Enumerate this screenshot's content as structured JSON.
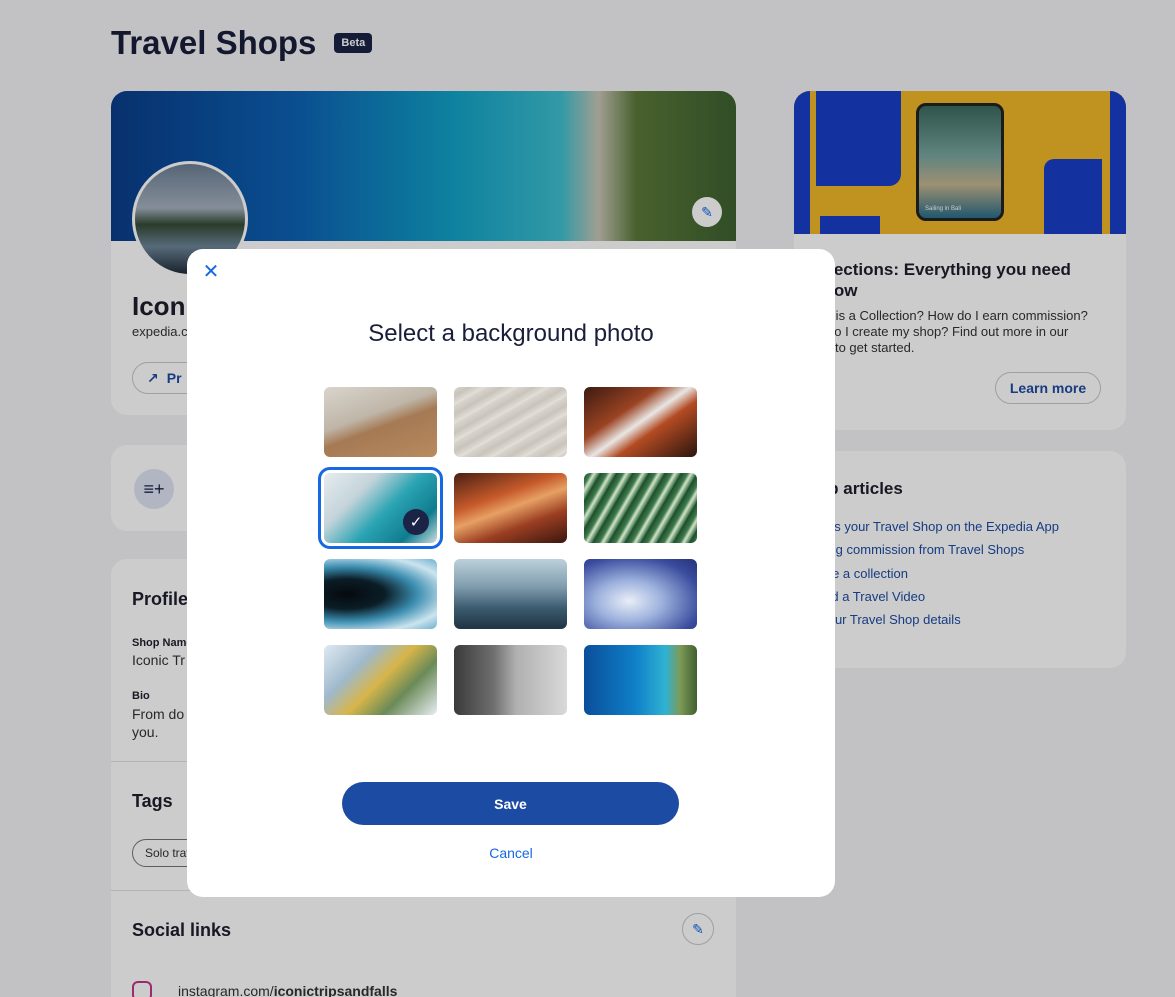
{
  "page": {
    "title": "Travel Shops",
    "beta_badge": "Beta"
  },
  "shop": {
    "name_partial": "Iconi",
    "url_partial": "expedia.c",
    "preview_partial": "Pr"
  },
  "profile": {
    "section_title_partial": "Profile",
    "shop_name_label_partial": "Shop Name",
    "shop_name_value_partial": "Iconic Tr",
    "bio_label": "Bio",
    "bio_value_line1_partial": "From do",
    "bio_value_line2": "you."
  },
  "tags": {
    "title": "Tags",
    "chip_partial": "Solo trav"
  },
  "social": {
    "title": "Social links",
    "instagram_prefix": "instagram.com/",
    "instagram_handle": "iconictripsandfalls"
  },
  "promo": {
    "phone_caption": "Sailing in Bali",
    "title": "ollections: Everything you need\n know",
    "body": "hat is a Collection? How do I earn commission?\nw do I create my shop? Find out more in our\nide to get started.",
    "learn_more": "Learn more"
  },
  "help": {
    "title": "elp articles",
    "links": [
      "cess your Travel Shop on the Expedia App",
      "rning commission from Travel Shops",
      "eate a collection",
      "load a Travel Video",
      "t your Travel Shop details"
    ]
  },
  "modal": {
    "close_icon": "close-icon",
    "title": "Select a background photo",
    "selected_index": 3,
    "photos": [
      "beach-sand-photo",
      "sand-dunes-photo",
      "canyon-orange-photo",
      "glacier-teal-photo",
      "antelope-canyon-photo",
      "green-leaves-photo",
      "ice-cave-photo",
      "misty-mountains-photo",
      "blue-clouds-photo",
      "yellow-flowers-photo",
      "grey-rock-photo",
      "coastline-aerial-photo"
    ],
    "save_label": "Save",
    "cancel_label": "Cancel"
  },
  "colors": {
    "accent": "#1668e3",
    "primary_button": "#1c4ba3",
    "title_text": "#191e3b"
  }
}
